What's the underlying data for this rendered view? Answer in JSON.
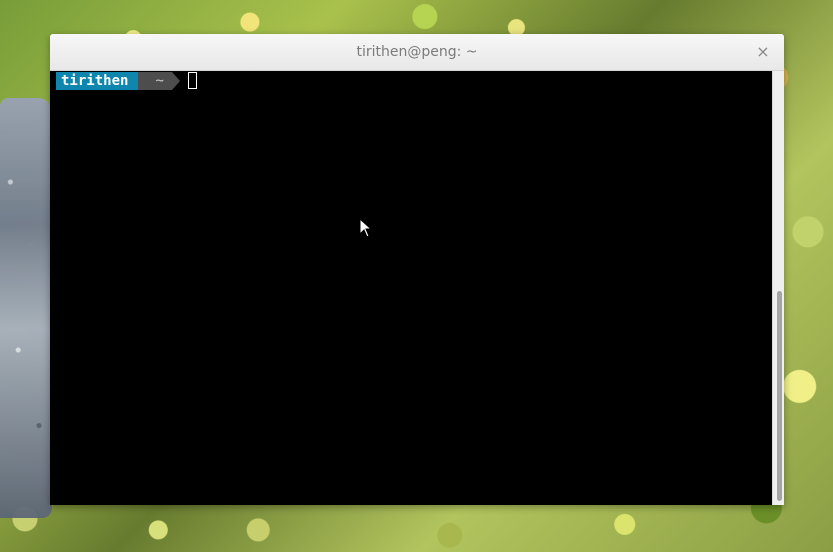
{
  "window": {
    "title": "tirithen@peng: ~",
    "close_label": "×"
  },
  "terminal": {
    "prompt_user": "tirithen",
    "prompt_path": "~"
  },
  "icons": {
    "close": "close-icon",
    "pointer": "mouse-pointer-icon",
    "cursor": "text-cursor-icon"
  }
}
